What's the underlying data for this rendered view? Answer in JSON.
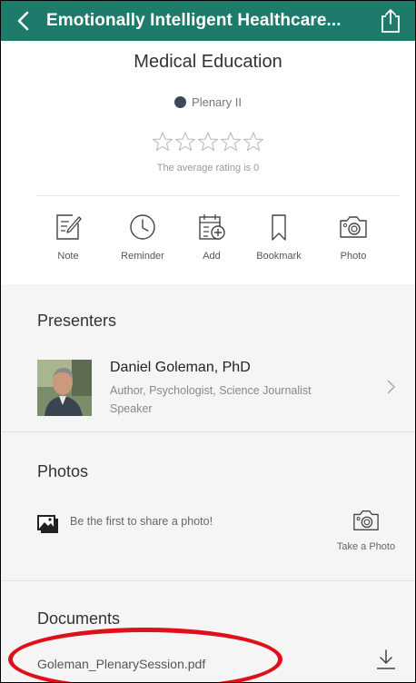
{
  "header": {
    "title": "Emotionally Intelligent Healthcare...",
    "background_color": "#1e7a6a",
    "back_icon": "chevron-left-icon",
    "share_icon": "share-icon"
  },
  "session": {
    "category": "Medical Education",
    "location": "Plenary II",
    "rating_text": "The average rating is 0",
    "stars_total": 5,
    "rating": 0
  },
  "actions": [
    {
      "label": "Note",
      "icon": "note-icon"
    },
    {
      "label": "Reminder",
      "icon": "clock-icon"
    },
    {
      "label": "Add",
      "icon": "calendar-add-icon"
    },
    {
      "label": "Bookmark",
      "icon": "bookmark-icon"
    },
    {
      "label": "Photo",
      "icon": "camera-icon"
    }
  ],
  "presenters": {
    "title": "Presenters",
    "items": [
      {
        "name": "Daniel Goleman, PhD",
        "role": "Author, Psychologist, Science Journalist",
        "type": "Speaker"
      }
    ]
  },
  "photos": {
    "title": "Photos",
    "empty_text": "Be the first to share a photo!",
    "take_photo_label": "Take a Photo"
  },
  "documents": {
    "title": "Documents",
    "items": [
      {
        "name": "Goleman_PlenarySession.pdf",
        "icon": "download-icon"
      }
    ],
    "highlight_color": "#e0101a"
  }
}
